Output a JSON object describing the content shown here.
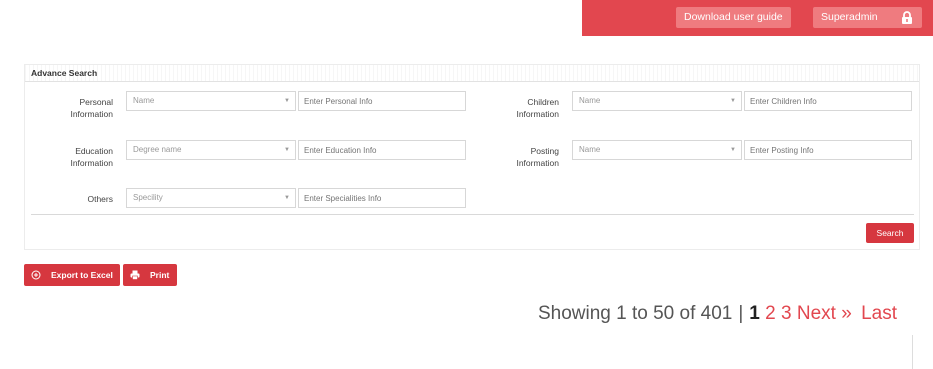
{
  "header": {
    "download_label": "Download user guide",
    "user_label": "Superadmin",
    "accent": "#e2474f"
  },
  "panel": {
    "title": "Advance Search"
  },
  "search": {
    "personal": {
      "label_line1": "Personal",
      "label_line2": "Information",
      "select_value": "Name",
      "input_placeholder": "Enter Personal Info"
    },
    "children": {
      "label_line1": "Children",
      "label_line2": "Information",
      "select_value": "Name",
      "input_placeholder": "Enter Children Info"
    },
    "education": {
      "label_line1": "Education",
      "label_line2": "Information",
      "select_value": "Degree name",
      "input_placeholder": "Enter Education Info"
    },
    "posting": {
      "label_line1": "Posting",
      "label_line2": "Information",
      "select_value": "Name",
      "input_placeholder": "Enter Posting Info"
    },
    "others": {
      "label": "Others",
      "select_value": "Specility",
      "input_placeholder": "Enter Specialities Info"
    },
    "search_label": "Search"
  },
  "actions": {
    "export_label": "Export to Excel",
    "export_icon": "plus-circle-icon",
    "print_label": "Print",
    "print_icon": "printer-icon"
  },
  "pagination": {
    "summary": "Showing 1 to 50 of 401",
    "separator": "|",
    "current": "1",
    "pages": [
      "2",
      "3"
    ],
    "next_label": "Next »",
    "last_label": "Last"
  }
}
